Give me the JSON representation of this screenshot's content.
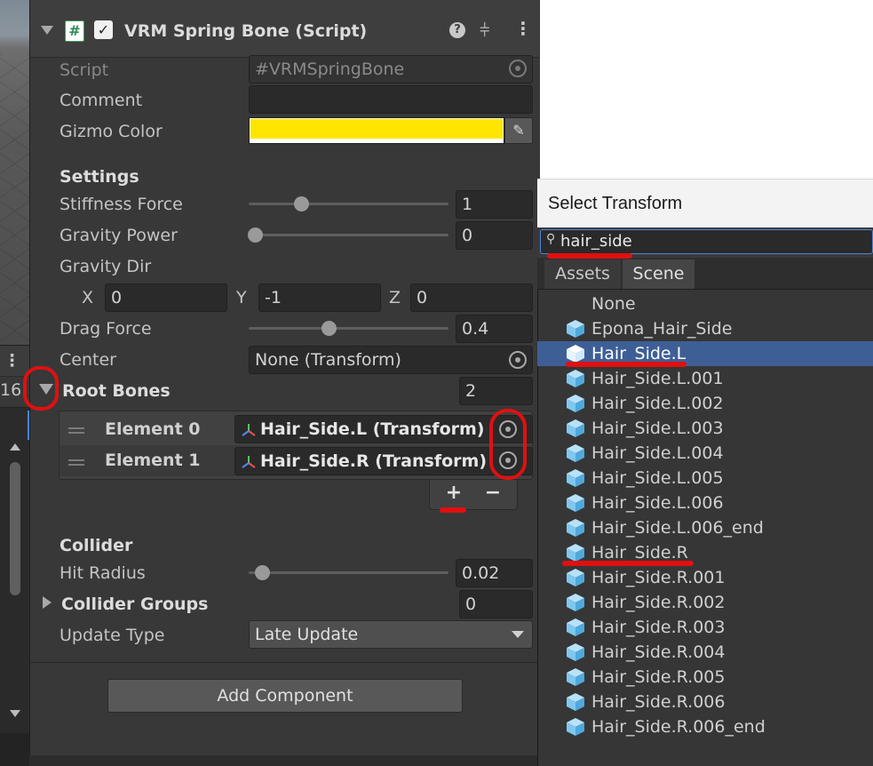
{
  "inspector": {
    "component_title": "VRM Spring Bone (Script)",
    "script_label": "Script",
    "script_value": "VRMSpringBone",
    "comment_label": "Comment",
    "comment_value": "",
    "gizmo_color_label": "Gizmo Color",
    "gizmo_color": "#ffe600",
    "settings_header": "Settings",
    "stiffness_label": "Stiffness Force",
    "stiffness_value": "1",
    "stiffness_fraction": 0.25,
    "gravity_power_label": "Gravity Power",
    "gravity_power_value": "0",
    "gravity_power_fraction": 0.0,
    "gravity_dir_label": "Gravity Dir",
    "x_label": "X",
    "x_value": "0",
    "y_label": "Y",
    "y_value": "-1",
    "z_label": "Z",
    "z_value": "0",
    "drag_label": "Drag Force",
    "drag_value": "0.4",
    "drag_fraction": 0.4,
    "center_label": "Center",
    "center_value": "None (Transform)",
    "root_bones_label": "Root Bones",
    "root_bones_count": "2",
    "elements": [
      {
        "label": "Element 0",
        "value": "Hair_Side.L (Transform)"
      },
      {
        "label": "Element 1",
        "value": "Hair_Side.R (Transform)"
      }
    ],
    "add_symbol": "+",
    "remove_symbol": "−",
    "collider_header": "Collider",
    "hit_radius_label": "Hit Radius",
    "hit_radius_value": "0.02",
    "hit_radius_fraction": 0.02,
    "collider_groups_label": "Collider Groups",
    "collider_groups_count": "0",
    "update_type_label": "Update Type",
    "update_type_value": "Late Update",
    "add_component_label": "Add Component"
  },
  "left_strip": {
    "count_text": "16"
  },
  "popup": {
    "title": "Select Transform",
    "search_value": "hair_side",
    "tabs": [
      "Assets",
      "Scene"
    ],
    "active_tab": "Scene",
    "none_label": "None",
    "items": [
      "Epona_Hair_Side",
      "Hair_Side.L",
      "Hair_Side.L.001",
      "Hair_Side.L.002",
      "Hair_Side.L.003",
      "Hair_Side.L.004",
      "Hair_Side.L.005",
      "Hair_Side.L.006",
      "Hair_Side.L.006_end",
      "Hair_Side.R",
      "Hair_Side.R.001",
      "Hair_Side.R.002",
      "Hair_Side.R.003",
      "Hair_Side.R.004",
      "Hair_Side.R.005",
      "Hair_Side.R.006",
      "Hair_Side.R.006_end"
    ],
    "selected_item": "Hair_Side.L"
  },
  "colors": {
    "annotation_red": "#e01010",
    "selection_blue": "#3e5f96",
    "cube_blue": "#7ec8f0"
  }
}
